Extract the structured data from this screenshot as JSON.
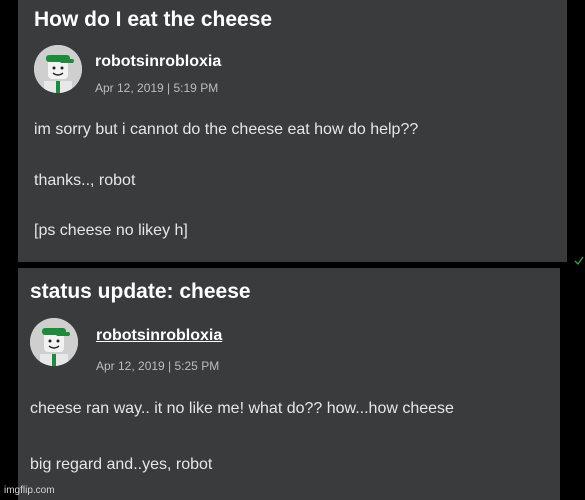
{
  "posts": [
    {
      "title": "How do I eat the cheese",
      "author": "robotsinrobloxia",
      "meta": "Apr 12, 2019 | 5:19 PM",
      "lines": [
        "im sorry but i cannot do the cheese eat how do help??",
        "thanks.., robot",
        "[ps cheese no likey h]"
      ]
    },
    {
      "title": "status update: cheese",
      "author": "robotsinrobloxia",
      "meta": "Apr 12, 2019 | 5:25 PM",
      "lines": [
        "cheese ran way.. it no like me! what do?? how...how cheese",
        "big regard and..yes, robot"
      ]
    }
  ],
  "watermark": "imgflip.com",
  "colors": {
    "background": "#000000",
    "panel": "#393b3d",
    "text": "#e6e6e6",
    "cap": "#1f8a3c"
  },
  "icons": [
    "avatar-robot-green-cap",
    "green-check-mark"
  ]
}
